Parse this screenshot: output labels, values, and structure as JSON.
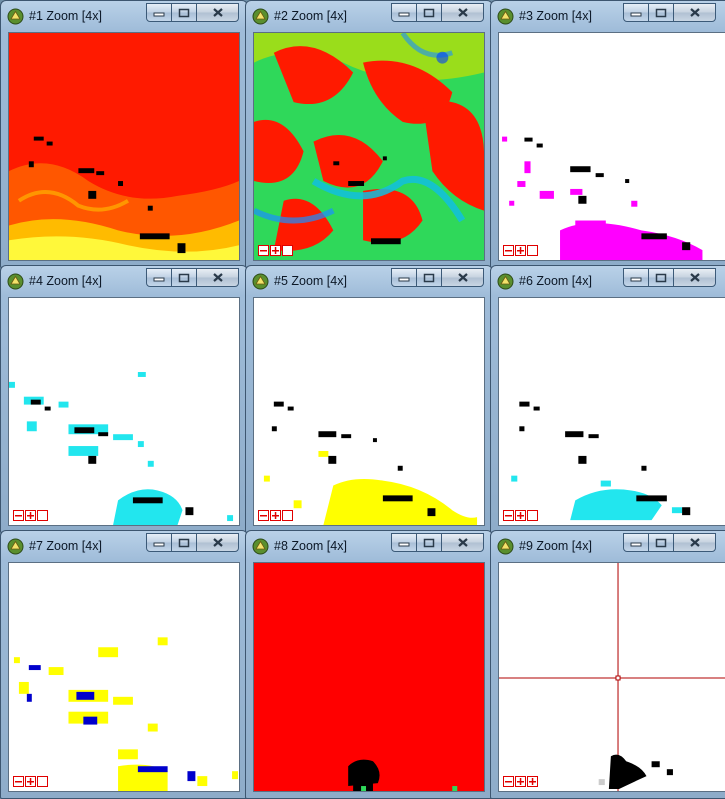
{
  "windows": [
    {
      "title": "#1 Zoom [4x]"
    },
    {
      "title": "#2 Zoom [4x]"
    },
    {
      "title": "#3 Zoom [4x]"
    },
    {
      "title": "#4 Zoom [4x]"
    },
    {
      "title": "#5 Zoom [4x]"
    },
    {
      "title": "#6 Zoom [4x]"
    },
    {
      "title": "#7 Zoom [4x]"
    },
    {
      "title": "#8 Zoom [4x]"
    },
    {
      "title": "#9 Zoom [4x]"
    }
  ],
  "colors": {
    "red": "#ff0000",
    "magenta": "#ff00ff",
    "cyan": "#22e6ee",
    "yellow": "#ffff00",
    "blue": "#0000cc",
    "black": "#000000",
    "crosshair": "#b00000"
  },
  "icons": {
    "app": "zoom-app-icon",
    "minimize": "minimize-icon",
    "maximize": "maximize-icon",
    "close": "close-icon",
    "zoom_out": "zoom-out-icon",
    "zoom_in": "zoom-in-icon",
    "zoom_reset": "zoom-reset-icon"
  }
}
